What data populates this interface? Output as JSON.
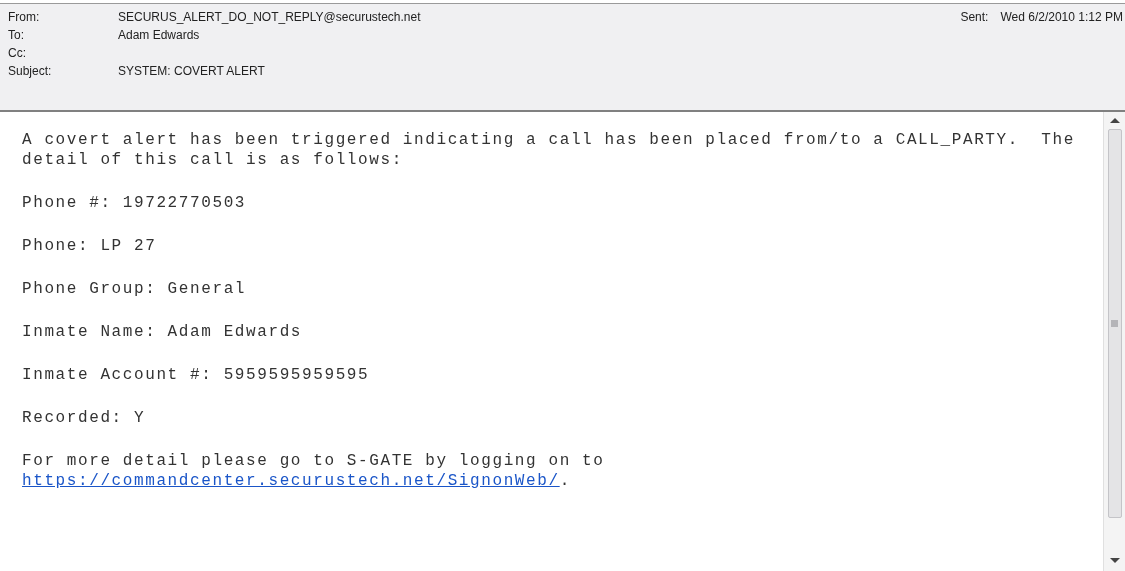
{
  "header": {
    "fields": [
      {
        "label": "From:",
        "value": "SECURUS_ALERT_DO_NOT_REPLY@securustech.net"
      },
      {
        "label": "To:",
        "value": "Adam Edwards"
      },
      {
        "label": "Cc:"
      },
      {
        "label": "Subject:",
        "value": "SYSTEM: COVERT ALERT"
      }
    ],
    "sent": {
      "label": "Sent:",
      "value": "Wed 6/2/2010 1:12 PM"
    }
  },
  "body": {
    "paragraphs": [
      {
        "lines": [
          "A covert alert has been triggered indicating a call has been placed from/to a CALL_PARTY.  The",
          "detail of this call is as follows:"
        ]
      },
      {
        "lines": [
          "Phone #: 19722770503"
        ]
      },
      {
        "lines": [
          "Phone: LP 27"
        ]
      },
      {
        "lines": [
          "Phone Group: General"
        ]
      },
      {
        "lines": [
          "Inmate Name: Adam Edwards"
        ]
      },
      {
        "lines": [
          "Inmate Account #: 5959595959595"
        ]
      },
      {
        "lines": [
          "Recorded: Y"
        ]
      },
      {
        "lines": [
          "For more detail please go to S-GATE by logging on to"
        ],
        "link": "https://commandcenter.securustech.net/SignonWeb/",
        "after": "."
      }
    ]
  }
}
